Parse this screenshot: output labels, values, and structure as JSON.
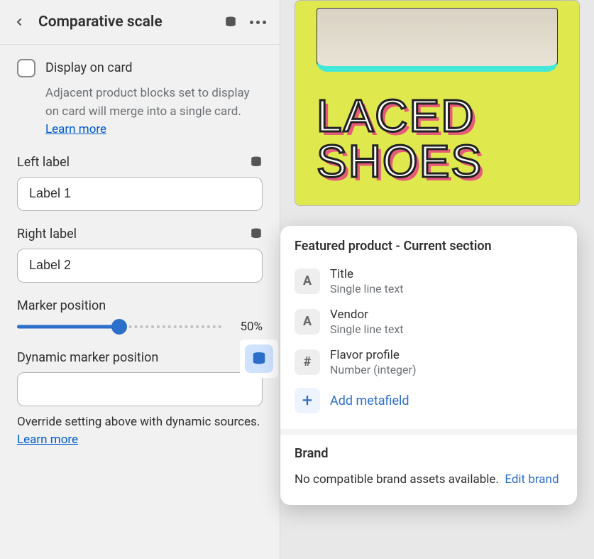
{
  "header": {
    "title": "Comparative scale"
  },
  "display_on_card": {
    "label": "Display on card",
    "checked": false,
    "help": "Adjacent product blocks set to display on card will merge into a single card.",
    "learn_more": "Learn more"
  },
  "left_label": {
    "label": "Left label",
    "value": "Label 1"
  },
  "right_label": {
    "label": "Right label",
    "value": "Label 2"
  },
  "marker_position": {
    "label": "Marker position",
    "value_pct": 50,
    "value_display": "50%"
  },
  "dynamic_marker": {
    "label": "Dynamic marker position",
    "value": "",
    "help": "Override setting above with dynamic sources.",
    "learn_more": "Learn more"
  },
  "popover": {
    "title": "Featured product - Current section",
    "items": [
      {
        "icon": "A",
        "name": "Title",
        "type": "Single line text"
      },
      {
        "icon": "A",
        "name": "Vendor",
        "type": "Single line text"
      },
      {
        "icon": "#",
        "name": "Flavor profile",
        "type": "Number (integer)"
      }
    ],
    "add_label": "Add metafield",
    "brand": {
      "title": "Brand",
      "text": "No compatible brand assets available.",
      "link": "Edit brand"
    }
  },
  "preview": {
    "product_title_line1": "LACED",
    "product_title_line2": "SHOES"
  }
}
